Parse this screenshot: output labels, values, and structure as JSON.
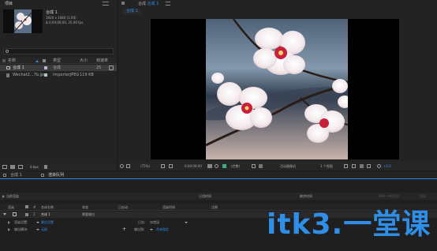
{
  "project_panel": {
    "title": "项目",
    "comp_name": "合成 1",
    "comp_line1": "1920 x 1080 (1.00)",
    "comp_line2": "Δ 0;00;00;00, 25.00 fps",
    "search_placeholder": "",
    "columns": {
      "name": "名称",
      "type": "类型",
      "size": "大小",
      "fps": "帧速率"
    },
    "rows": [
      {
        "name": "合成 1",
        "type": "合成",
        "size": "",
        "fps": "25"
      },
      {
        "name": "Wechat2...7b.jpg",
        "type": "ImporterJPEG",
        "size": "119 KB",
        "fps": ""
      }
    ],
    "bpc": "8 bpc"
  },
  "viewer": {
    "tab_label": "合成",
    "tab_comp": "合成 1",
    "sub_tab": "合成 1",
    "zoom": "(75%)",
    "timecode": "0:00:00:00",
    "resolution": "(完整)",
    "camera": "活动摄像机",
    "views": "1 个视图",
    "exposure": "+0.0"
  },
  "bottom_tabs": {
    "comp": "合成 1",
    "render_queue": "渲染队列"
  },
  "render_bar": {
    "current_render": "当前渲染",
    "elapsed": "已用时间",
    "remaining": "剩余时间",
    "ame_queue": "AME 中的队列",
    "render": "渲染"
  },
  "render_table": {
    "columns": {
      "render": "渲染",
      "num": "#",
      "comp": "合成名称",
      "status": "状态",
      "started": "已启动",
      "render_time": "渲染时间",
      "comment": "注释"
    },
    "row": {
      "num": "1",
      "comp": "合成 1",
      "status": "需要输出"
    },
    "render_settings_label": "渲染设置:",
    "render_settings_value": "最佳设置",
    "output_module_label": "输出模块:",
    "output_module_value": "无损",
    "log_label": "日志:",
    "log_value": "仅错误",
    "output_to_label": "输出到:",
    "output_to_value": "尚未指定"
  },
  "watermark": "itk3.一堂课",
  "colors": {
    "accent": "#2d8ceb",
    "watermark": "#2f8fe8"
  }
}
